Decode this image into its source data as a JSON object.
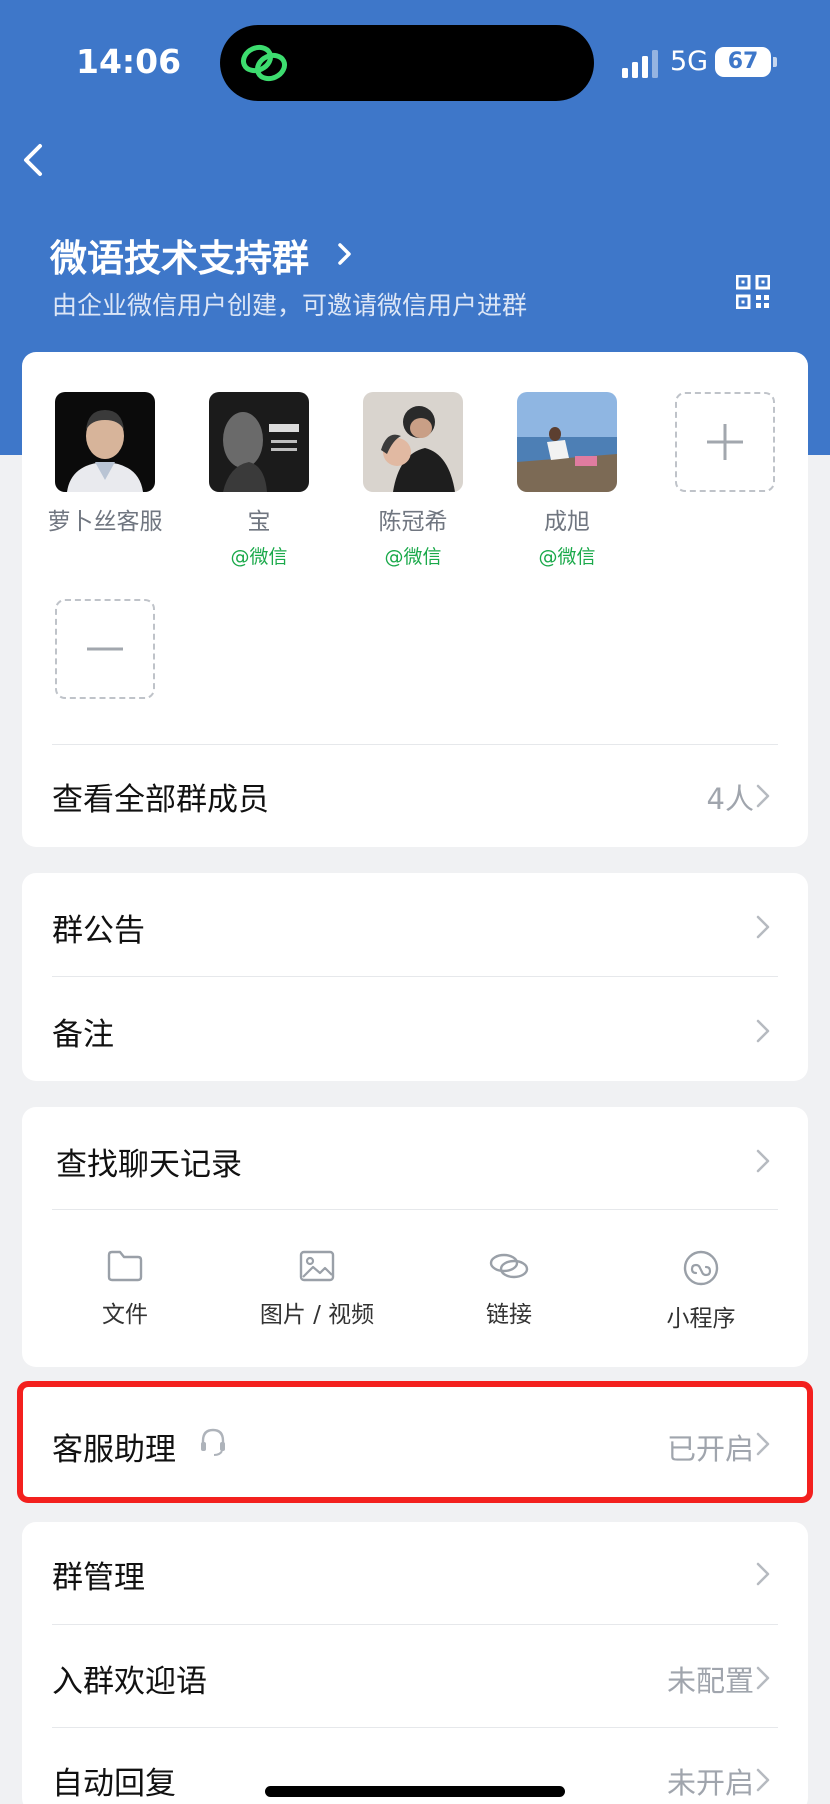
{
  "status_bar": {
    "time": "14:06",
    "network": "5G",
    "battery": "67"
  },
  "header": {
    "title": "微语技术支持群",
    "subtitle": "由企业微信用户创建，可邀请微信用户进群"
  },
  "members": [
    {
      "name": "萝卜丝客服",
      "tag": ""
    },
    {
      "name": "宝",
      "tag": "@微信"
    },
    {
      "name": "陈冠希",
      "tag": "@微信"
    },
    {
      "name": "成旭",
      "tag": "@微信"
    }
  ],
  "view_all": {
    "label": "查看全部群成员",
    "count": "4人"
  },
  "section2": [
    {
      "label": "群公告"
    },
    {
      "label": "备注"
    }
  ],
  "search": {
    "label": "查找聊天记录",
    "tools": [
      {
        "label": "文件",
        "icon": "folder-icon"
      },
      {
        "label": "图片 / 视频",
        "icon": "image-icon"
      },
      {
        "label": "链接",
        "icon": "link-icon"
      },
      {
        "label": "小程序",
        "icon": "miniprogram-icon"
      }
    ]
  },
  "assistant": {
    "label": "客服助理",
    "value": "已开启",
    "icon": "headset-icon"
  },
  "section5": [
    {
      "label": "群管理",
      "value": ""
    },
    {
      "label": "入群欢迎语",
      "value": "未配置"
    },
    {
      "label": "自动回复",
      "value": "未开启"
    }
  ],
  "colors": {
    "header_blue": "#3e77c9",
    "highlight_red": "#f3201e",
    "wechat_green": "#1aa94a"
  }
}
